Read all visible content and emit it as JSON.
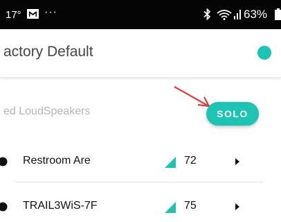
{
  "status_bar": {
    "time": "17°",
    "more_indicator": "···",
    "battery_text": "63%",
    "icons": [
      "message-icon",
      "bluetooth-icon",
      "wifi-icon",
      "signal-icon",
      "battery-icon"
    ]
  },
  "header": {
    "title": "actory Default",
    "status_color": "#1dc4b4"
  },
  "section": {
    "label": "ed LoudSpeakers",
    "solo_label": "SOLO",
    "annotation": "red arrow pointing to SOLO button"
  },
  "speakers": [
    {
      "name": "Restroom Are",
      "level": "72"
    },
    {
      "name": "TRAIL3WiS-7F",
      "level": "75"
    }
  ],
  "colors": {
    "accent": "#1dc4b4",
    "annotation": "#e53935"
  }
}
